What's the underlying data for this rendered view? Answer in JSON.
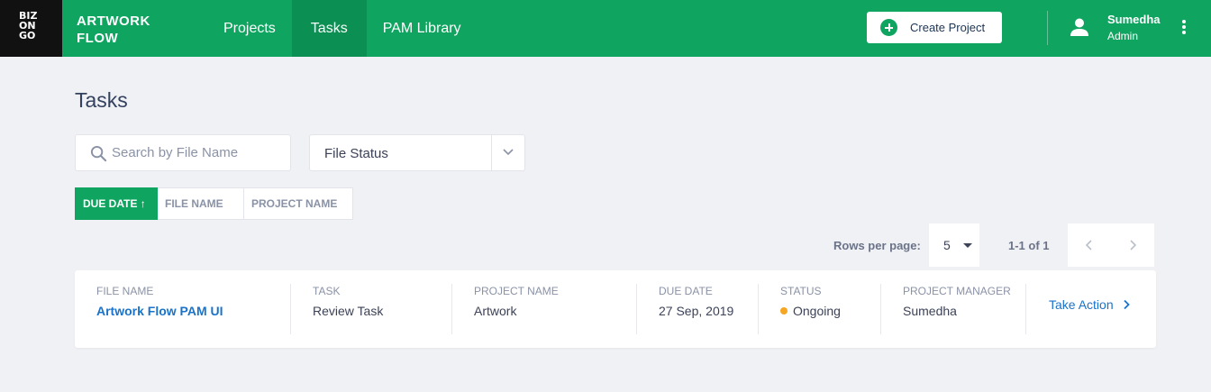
{
  "header": {
    "logo_lines": [
      "BIZ",
      "ON",
      "GO"
    ],
    "brand_lines": [
      "ARTWORK",
      "FLOW"
    ],
    "nav": [
      {
        "label": "Projects",
        "active": false
      },
      {
        "label": "Tasks",
        "active": true
      },
      {
        "label": "PAM Library",
        "active": false
      }
    ],
    "create_label": "Create Project",
    "user": {
      "name": "Sumedha",
      "role": "Admin"
    },
    "colors": {
      "brand_green": "#0fa45f",
      "active_tab": "#0c8f52",
      "logo_bg": "#111111"
    },
    "icons": [
      "plus-circle-icon",
      "user-icon",
      "kebab-menu-icon"
    ]
  },
  "page": {
    "title": "Tasks",
    "search": {
      "placeholder": "Search by File Name",
      "value": ""
    },
    "status_filter": {
      "value": "File Status"
    },
    "sort": [
      {
        "label": "DUE DATE ↑",
        "active": true
      },
      {
        "label": "FILE NAME",
        "active": false
      },
      {
        "label": "PROJECT NAME",
        "active": false
      }
    ]
  },
  "pagination": {
    "rows_label": "Rows per page:",
    "rows_value": "5",
    "range": "1-1 of 1"
  },
  "tasks": {
    "headers": {
      "file_name": "FILE NAME",
      "task": "TASK",
      "project_name": "PROJECT NAME",
      "due_date": "DUE DATE",
      "status": "STATUS",
      "project_manager": "PROJECT MANAGER"
    },
    "rows": [
      {
        "file_name": "Artwork Flow PAM UI",
        "task": "Review Task",
        "project_name": "Artwork",
        "due_date": "27 Sep, 2019",
        "status": "Ongoing",
        "status_color": "#f5a623",
        "project_manager": "Sumedha",
        "action_label": "Take Action"
      }
    ]
  }
}
